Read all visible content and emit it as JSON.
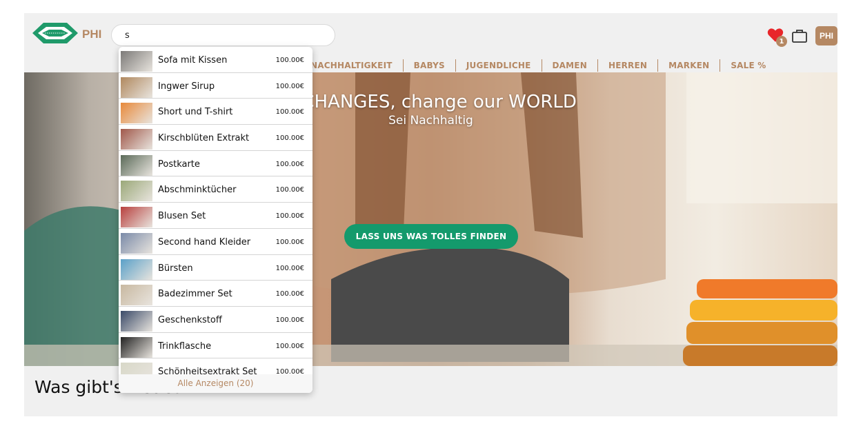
{
  "header": {
    "brand": "PHI",
    "search_value": "s",
    "nav": [
      "NACHHALTIGKEIT",
      "BABYS",
      "JUGENDLICHE",
      "DAMEN",
      "HERREN",
      "MARKEN",
      "SALE %"
    ],
    "wishlist_count": "1",
    "avatar_label": "PHI"
  },
  "hero": {
    "title": "e CHANGES, change our WORLD",
    "subtitle": "Sei Nachhaltig",
    "cta": "LASS UNS WAS TOLLES FINDEN"
  },
  "section_title": "Was gibt's Neues",
  "dropdown": {
    "items": [
      {
        "name": "Sofa mit Kissen",
        "price": "100.00€",
        "thumb": "#7c7a78"
      },
      {
        "name": "Ingwer Sirup",
        "price": "100.00€",
        "thumb": "#b0885e"
      },
      {
        "name": "Short und T-shirt",
        "price": "100.00€",
        "thumb": "#e8893a"
      },
      {
        "name": "Kirschblüten Extrakt",
        "price": "100.00€",
        "thumb": "#a0584a"
      },
      {
        "name": "Postkarte",
        "price": "100.00€",
        "thumb": "#5a6a58"
      },
      {
        "name": "Abschminktücher",
        "price": "100.00€",
        "thumb": "#9aa878"
      },
      {
        "name": "Blusen Set",
        "price": "100.00€",
        "thumb": "#b8403e"
      },
      {
        "name": "Second hand Kleider",
        "price": "100.00€",
        "thumb": "#7a8aa8"
      },
      {
        "name": "Bürsten",
        "price": "100.00€",
        "thumb": "#5aa0c8"
      },
      {
        "name": "Badezimmer Set",
        "price": "100.00€",
        "thumb": "#c8b8a0"
      },
      {
        "name": "Geschenkstoff",
        "price": "100.00€",
        "thumb": "#3a4a68"
      },
      {
        "name": "Trinkflasche",
        "price": "100.00€",
        "thumb": "#222222"
      },
      {
        "name": "Schönheitsextrakt Set",
        "price": "100.00€",
        "thumb": "#d8d8c8"
      }
    ],
    "footer": "Alle Anzeigen (20)"
  },
  "colors": {
    "brand": "#b58863",
    "accent_green": "#149a6c",
    "heart": "#e8262a",
    "logo_green": "#1f9a6a"
  }
}
